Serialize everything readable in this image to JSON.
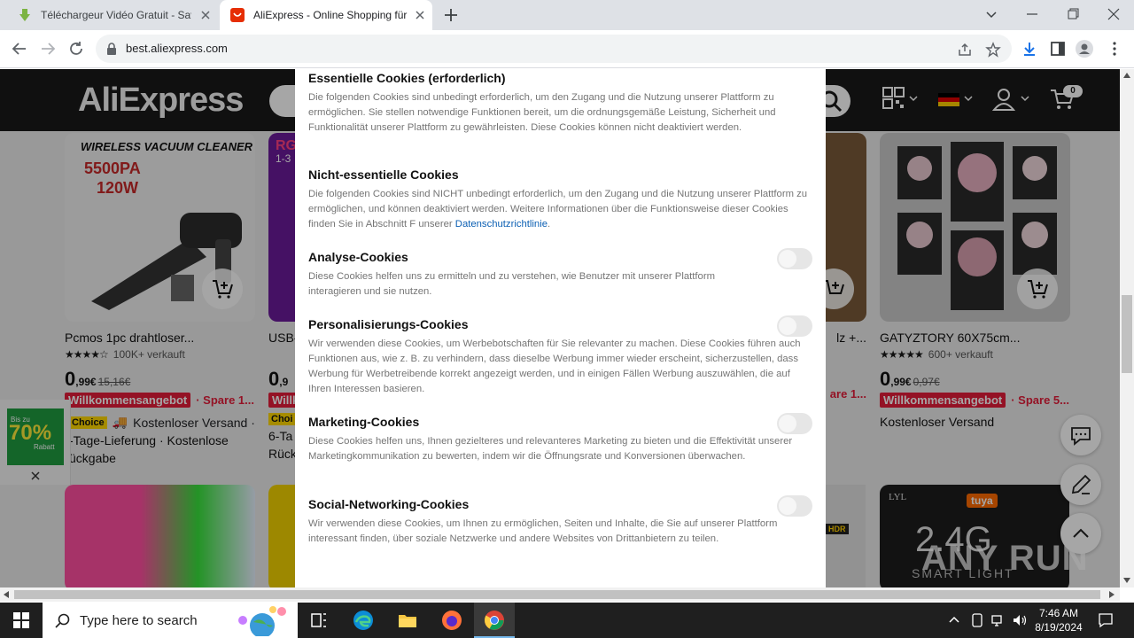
{
  "browser": {
    "tabs": [
      {
        "title": "Téléchargeur Vidéo Gratuit - Save"
      },
      {
        "title": "AliExpress - Online Shopping für"
      }
    ],
    "url": "best.aliexpress.com"
  },
  "site": {
    "logo": "AliExpress",
    "cart_count": "0",
    "products": [
      {
        "name": "Pcmos 1pc drahtloser...",
        "sold": "100K+ verkauft",
        "price_int": "0",
        "price_dec": ",99€",
        "old_price": "15,16€",
        "badge": "Willkommensangebot",
        "spare": "· Spare 1...",
        "choice": "Choice",
        "shipping": "Kostenloser Versand ·",
        "shipping2": "-Tage-Lieferung · Kostenlose",
        "shipping3": "ückgabe",
        "image_text": [
          "WIRELESS VACUUM CLEANER",
          "5500PA",
          "120W"
        ]
      },
      {
        "name": "USB-",
        "price_int": "0",
        "price_dec": ",9",
        "badge": "Willk",
        "choice": "Choi",
        "shipping2": "6-Ta",
        "shipping3": "Rück",
        "image_text": [
          "RG",
          "1-3"
        ]
      },
      {
        "name": "lz +...",
        "spare": "are 1...",
        "image_text": []
      },
      {
        "name": "GATYZTORY 60X75cm...",
        "sold": "600+ verkauft",
        "price_int": "0",
        "price_dec": ",99€",
        "old_price": "0,97€",
        "badge": "Willkommensangebot",
        "spare": "· Spare 5...",
        "shipping": "Kostenloser Versand"
      }
    ],
    "bottom_images": [
      {
        "text": []
      },
      {
        "text": [
          "HDR"
        ]
      },
      {
        "text": [
          "LYL",
          "tuya",
          "2.4G",
          "SMART LIGHT"
        ]
      }
    ],
    "side_promo": {
      "line1": "Bis zu",
      "line2": "70%",
      "line3": "Rabatt"
    },
    "watermark": "ANY RUN"
  },
  "cookies": {
    "sections": [
      {
        "title": "Essentielle Cookies (erforderlich)",
        "text": "Die folgenden Cookies sind unbedingt erforderlich, um den Zugang und die Nutzung unserer Plattform zu ermöglichen. Sie stellen notwendige Funktionen bereit, um die ordnungsgemäße Leistung, Sicherheit und Funktionalität unserer Plattform zu gewährleisten. Diese Cookies können nicht deaktiviert werden."
      },
      {
        "title": "Nicht-essentielle Cookies",
        "text": "Die folgenden Cookies sind NICHT unbedingt erforderlich, um den Zugang und die Nutzung unserer Plattform zu ermöglichen, und können deaktiviert werden. Weitere Informationen über die Funktionsweise dieser Cookies finden Sie in Abschnitt F unserer ",
        "link": "Datenschutzrichtlinie",
        "after_link": "."
      },
      {
        "title": "Analyse-Cookies",
        "text": "Diese Cookies helfen uns zu ermitteln und zu verstehen, wie Benutzer mit unserer Plattform interagieren und sie nutzen.",
        "enabled": false
      },
      {
        "title": "Personalisierungs-Cookies",
        "text": "Wir verwenden diese Cookies, um Werbebotschaften für Sie relevanter zu machen. Diese Cookies führen auch Funktionen aus, wie z. B. zu verhindern, dass dieselbe Werbung immer wieder erscheint, sicherzustellen, dass Werbung für Werbetreibende korrekt angezeigt werden, und in einigen Fällen Werbung auszuwählen, die auf Ihren Interessen basieren.",
        "enabled": false
      },
      {
        "title": "Marketing-Cookies",
        "text": "Diese Cookies helfen uns, Ihnen gezielteres und relevanteres Marketing zu bieten und die Effektivität unserer Marketingkommunikation zu bewerten, indem wir die Öffnungsrate und Konversionen überwachen.",
        "enabled": false
      },
      {
        "title": "Social-Networking-Cookies",
        "text": "Wir verwenden diese Cookies, um Ihnen zu ermöglichen, Seiten und Inhalte, die Sie auf unserer Plattform interessant finden, über soziale Netzwerke und andere Websites von Drittanbietern zu teilen.",
        "enabled": false
      }
    ]
  },
  "taskbar": {
    "search_placeholder": "Type here to search",
    "time": "7:46 AM",
    "date": "8/19/2024"
  },
  "colors": {
    "accent_red": "#e31d39",
    "link_blue": "#0b5fb3",
    "header_black": "#1a1a1a"
  }
}
